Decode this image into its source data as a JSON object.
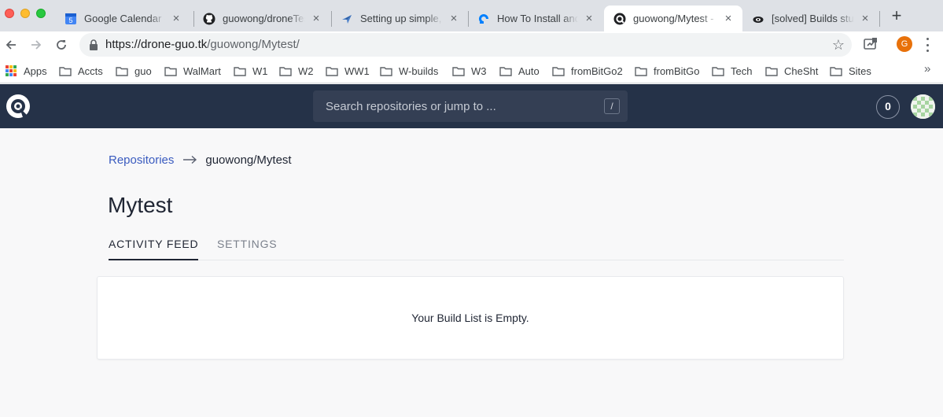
{
  "browser": {
    "tabs": [
      {
        "title": "Google Calendar - W",
        "favicon": "calendar-icon",
        "active": false
      },
      {
        "title": "guowong/droneTest",
        "favicon": "github-icon",
        "active": false
      },
      {
        "title": "Setting up simple, s",
        "favicon": "plane-icon",
        "active": false
      },
      {
        "title": "How To Install and C",
        "favicon": "digitalocean-icon",
        "active": false
      },
      {
        "title": "guowong/Mytest - D",
        "favicon": "drone-icon",
        "active": true
      },
      {
        "title": "[solved] Builds stuc",
        "favicon": "discourse-icon",
        "active": false
      }
    ],
    "calendar_day": "5",
    "address": {
      "host": "https://drone-guo.tk",
      "path": "/guowong/Mytest/"
    },
    "profile_initial": "G",
    "bookmarks": [
      "Apps",
      "Accts",
      "guo",
      "WalMart",
      "W1",
      "W2",
      "WW1",
      "W-builds",
      "W3",
      "Auto",
      "fromBitGo2",
      "fromBitGo",
      "Tech",
      "CheSht",
      "Sites"
    ],
    "more_bookmarks": "»"
  },
  "header": {
    "search_placeholder": "Search repositories or jump to ...",
    "search_shortcut": "/",
    "notification_count": "0"
  },
  "breadcrumb": {
    "root": "Repositories",
    "current": "guowong/Mytest"
  },
  "repo": {
    "title": "Mytest"
  },
  "page_tabs": [
    {
      "label": "ACTIVITY FEED",
      "active": true
    },
    {
      "label": "SETTINGS",
      "active": false
    }
  ],
  "builds": {
    "empty_message": "Your Build List is Empty."
  },
  "colors": {
    "header_bg": "#253248",
    "link": "#3a5bbf",
    "page_bg": "#f8f8f9",
    "profile": "#e8710a"
  }
}
